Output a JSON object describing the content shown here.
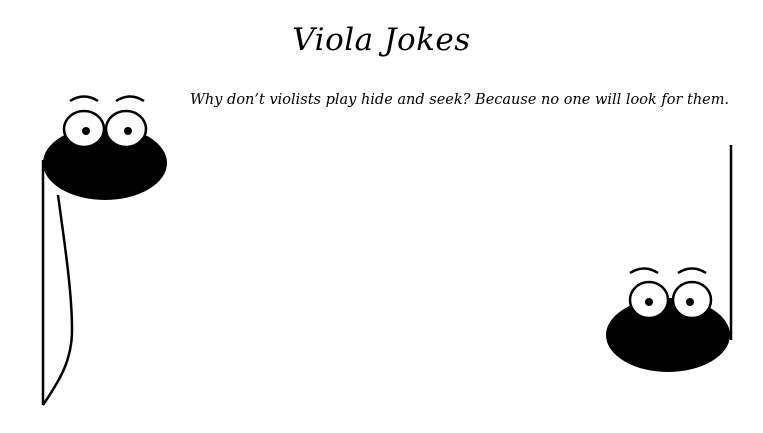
{
  "page": {
    "title": "Viola Jokes",
    "joke": "Why don’t violists play hide and seek? Because no one will look for them."
  },
  "colors": {
    "background": "#ffffff",
    "ink": "#000000"
  },
  "illustrations": {
    "left": "cartoon-music-note-icon",
    "right": "cartoon-music-note-icon"
  }
}
